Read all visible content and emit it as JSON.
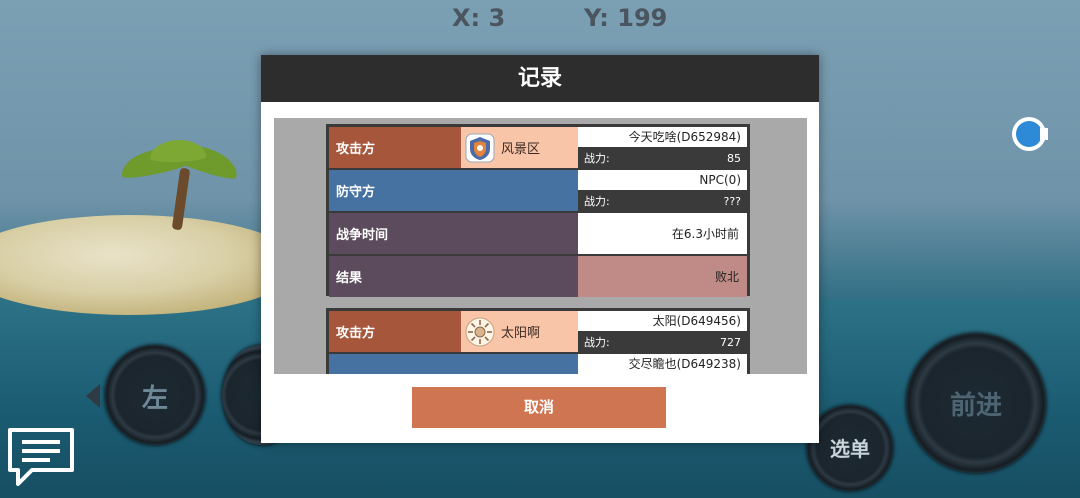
{
  "hud": {
    "x_label": "X: 3",
    "y_label": "Y: 199"
  },
  "controls": {
    "left_label": "左",
    "forward_label": "前进",
    "menu_label": "选单"
  },
  "icons": {
    "chat": "chat-bubble-icon",
    "camera": "camera-icon",
    "guild_1": "shield-emblem-icon",
    "guild_2": "sun-emblem-icon"
  },
  "modal": {
    "title": "记录",
    "cancel_label": "取消",
    "records": [
      {
        "attacker_label": "攻击方",
        "attacker_guild": "风景区",
        "attacker_name": "今天吃啥(D652984)",
        "attacker_power_label": "战力:",
        "attacker_power": "85",
        "defender_label": "防守方",
        "defender_name": "NPC(0)",
        "defender_power_label": "战力:",
        "defender_power": "???",
        "time_label": "战争时间",
        "time_value": "在6.3小时前",
        "result_label": "结果",
        "result_value": "败北"
      },
      {
        "attacker_label": "攻击方",
        "attacker_guild": "太阳啊",
        "attacker_name": "太阳(D649456)",
        "attacker_power_label": "战力:",
        "attacker_power": "727",
        "defender_name": "交尽瞻也(D649238)"
      }
    ]
  },
  "colors": {
    "attacker": "#a6563a",
    "defender": "#4672a2",
    "neutral_row": "#5c4b5c",
    "guild_bg": "#f8c5a8",
    "result_defeat": "#c08a86",
    "cancel_button": "#cf7552",
    "header": "#2d2d2d"
  }
}
